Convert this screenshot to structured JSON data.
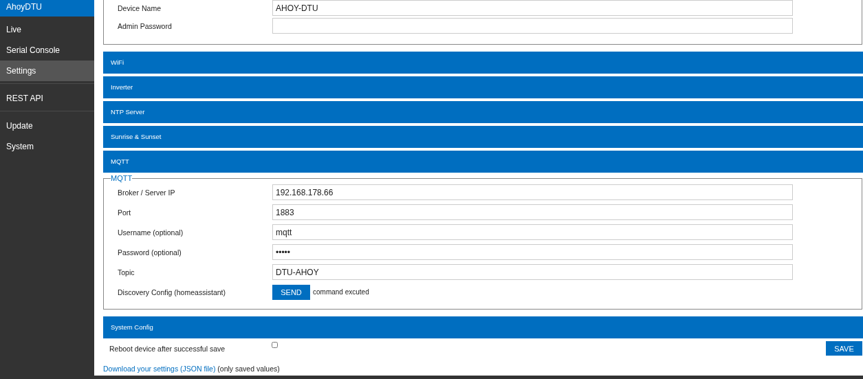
{
  "sidebar": {
    "title": "AhoyDTU",
    "groups": [
      [
        {
          "label": "Live",
          "selected": false
        },
        {
          "label": "Serial Console",
          "selected": false
        },
        {
          "label": "Settings",
          "selected": true
        }
      ],
      [
        {
          "label": "REST API",
          "selected": false
        }
      ],
      [
        {
          "label": "Update",
          "selected": false
        },
        {
          "label": "System",
          "selected": false
        }
      ]
    ]
  },
  "device_fields": [
    {
      "label": "Device Name",
      "value": "AHOY-DTU"
    },
    {
      "label": "Admin Password"
    }
  ],
  "sections": [
    {
      "title": "WiFi"
    },
    {
      "title": "Inverter"
    },
    {
      "title": "NTP Server"
    },
    {
      "title": "Sunrise & Sunset"
    },
    {
      "title": "MQTT",
      "legend": "MQTT",
      "fields": [
        {
          "kind": "input",
          "label": "Broker / Server IP",
          "value": "192.168.178.66"
        },
        {
          "kind": "input",
          "label": "Port",
          "value": "1883"
        },
        {
          "kind": "input",
          "label": "Username (optional)",
          "value": "mqtt"
        },
        {
          "kind": "input",
          "label": "Password (optional)",
          "value": "•••••"
        },
        {
          "kind": "input",
          "label": "Topic",
          "value": "DTU-AHOY"
        },
        {
          "kind": "button",
          "label": "Discovery Config (homeassistant)",
          "button": "SEND",
          "note": "command excuted"
        }
      ]
    },
    {
      "title": "System Config"
    }
  ],
  "reboot": {
    "label": "Reboot device after successful save",
    "checked": false
  },
  "save_button": "SAVE",
  "download": {
    "link": "Download your settings (JSON file)",
    "note": "(only saved values)"
  }
}
